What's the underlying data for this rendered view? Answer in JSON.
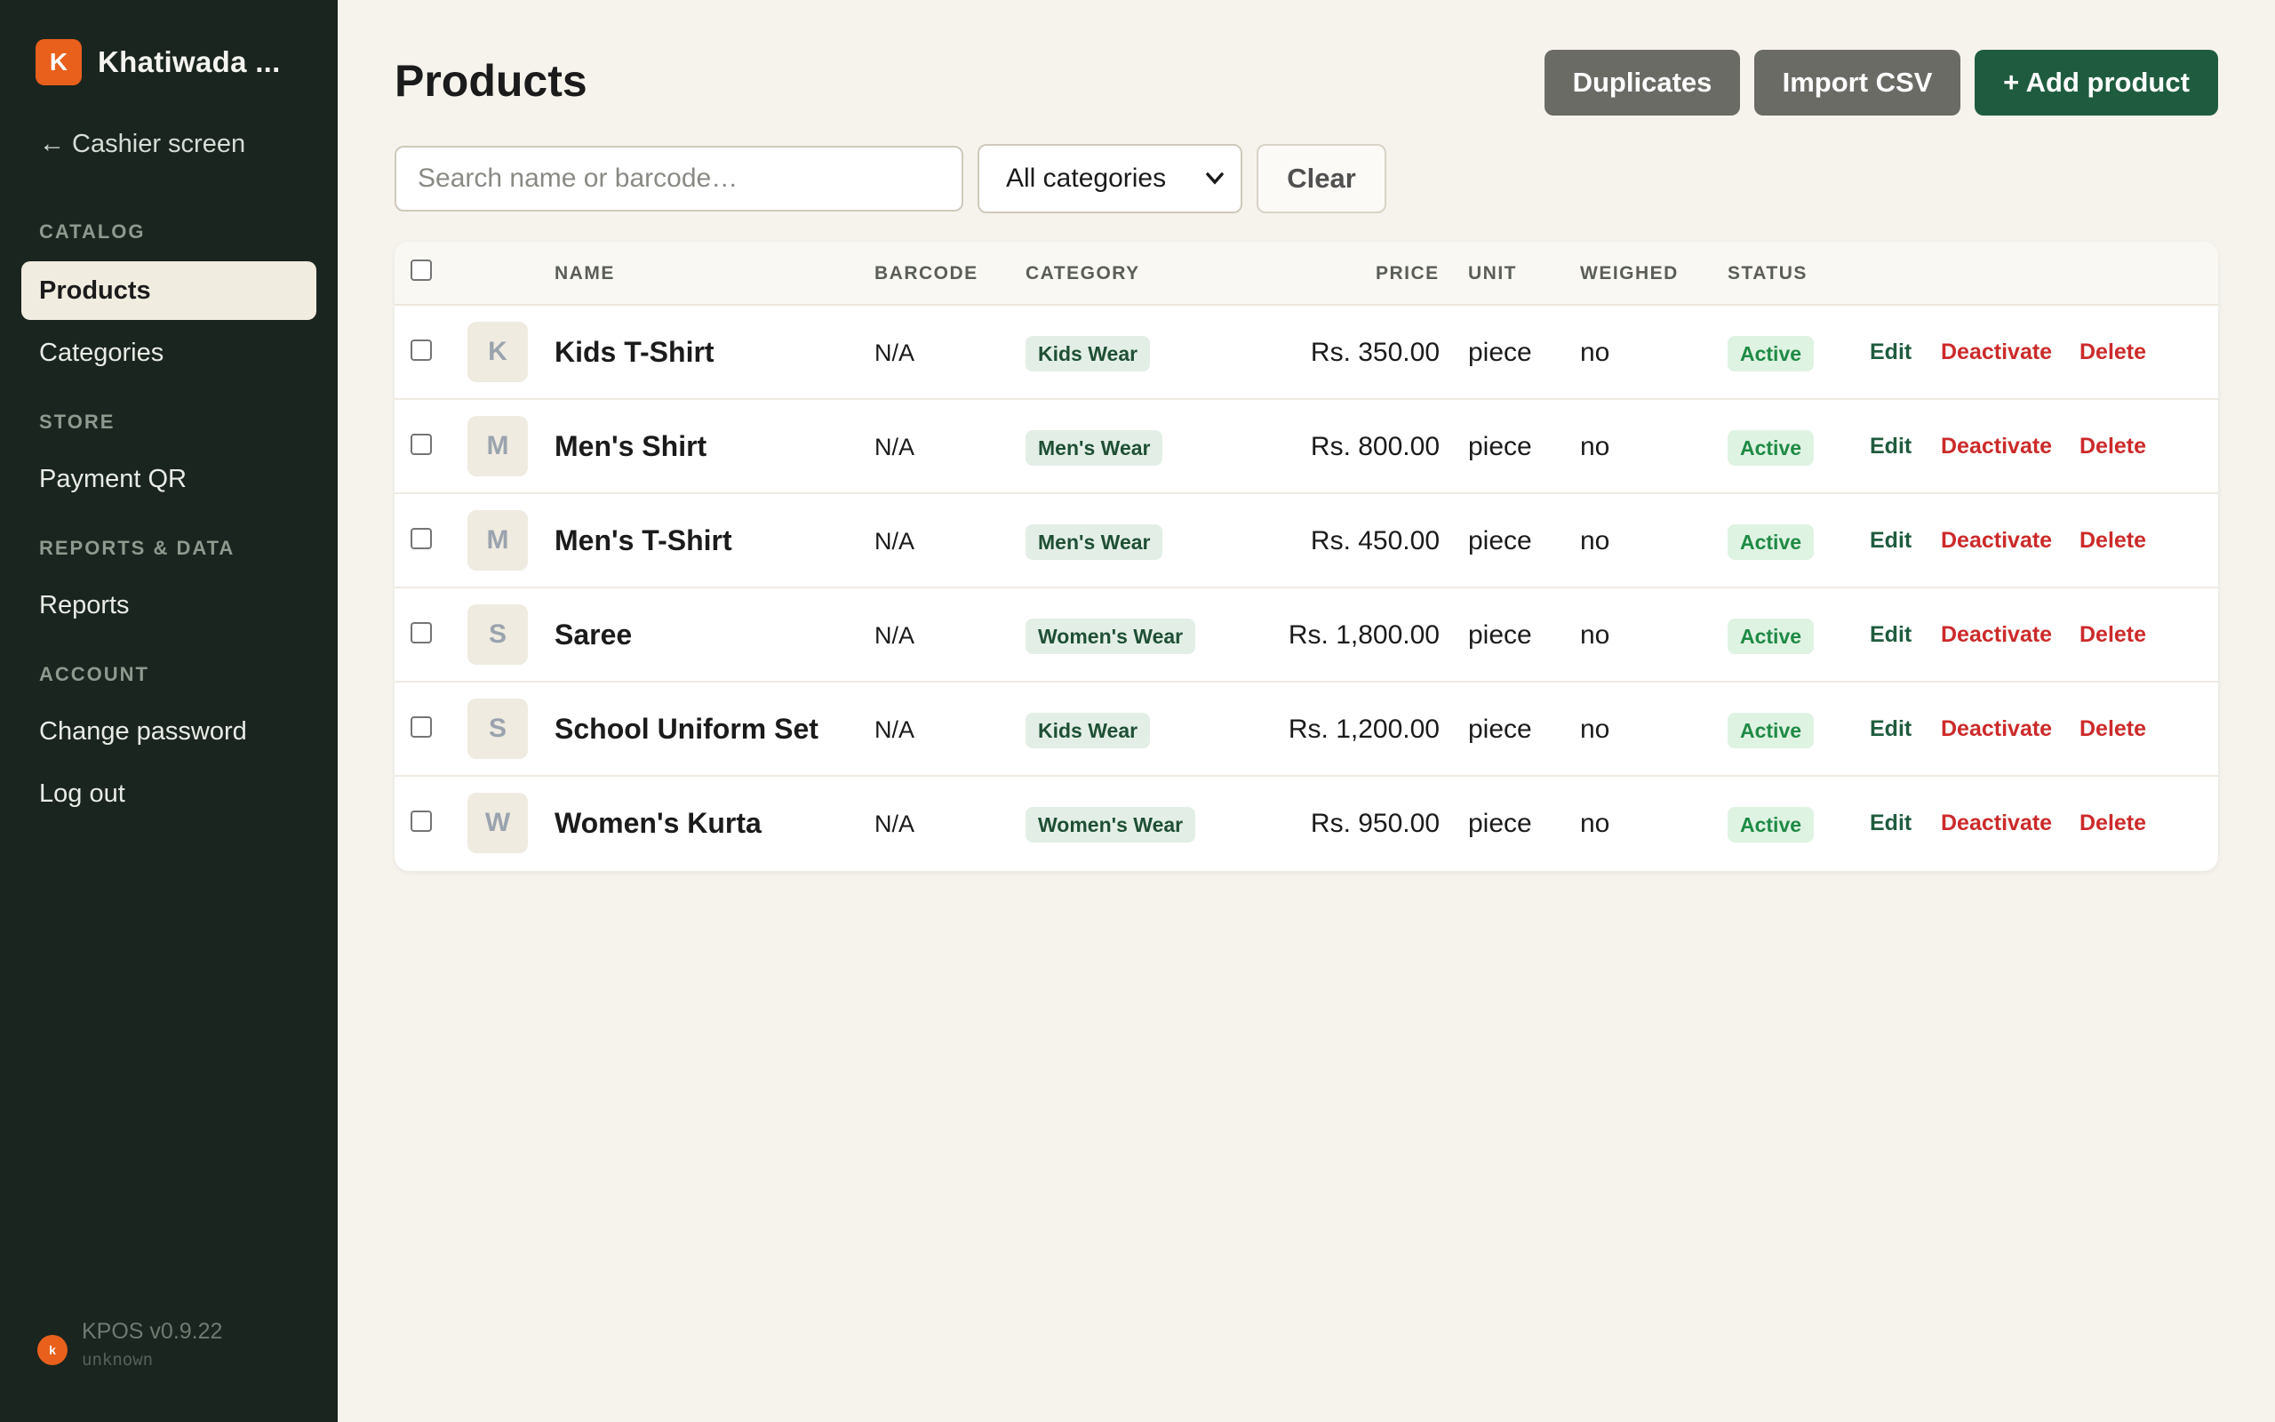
{
  "app": {
    "brand_initial": "K",
    "brand_name": "Khatiwada ..."
  },
  "sidebar": {
    "back_label": "← Cashier screen",
    "sections": [
      {
        "title": "CATALOG",
        "items": [
          {
            "label": "Products",
            "active": true
          },
          {
            "label": "Categories"
          }
        ]
      },
      {
        "title": "STORE",
        "items": [
          {
            "label": "Payment QR"
          }
        ]
      },
      {
        "title": "REPORTS & DATA",
        "items": [
          {
            "label": "Reports"
          }
        ]
      },
      {
        "title": "ACCOUNT",
        "items": [
          {
            "label": "Change password"
          },
          {
            "label": "Log out"
          }
        ]
      }
    ],
    "footer": {
      "logo_initial": "k",
      "version": "KPOS v0.9.22",
      "sub": "unknown"
    }
  },
  "header": {
    "title": "Products",
    "duplicates_label": "Duplicates",
    "import_label": "Import CSV",
    "add_label": "+ Add product"
  },
  "filters": {
    "search_placeholder": "Search name or barcode…",
    "search_value": "",
    "category_selected": "All categories",
    "clear_label": "Clear"
  },
  "table": {
    "columns": {
      "name": "NAME",
      "barcode": "BARCODE",
      "category": "CATEGORY",
      "price": "PRICE",
      "unit": "UNIT",
      "weighed": "WEIGHED",
      "status": "STATUS"
    },
    "actions": {
      "edit": "Edit",
      "deactivate": "Deactivate",
      "delete": "Delete"
    },
    "rows": [
      {
        "initial": "K",
        "name": "Kids T-Shirt",
        "barcode": "N/A",
        "category": "Kids Wear",
        "price": "Rs. 350.00",
        "unit": "piece",
        "weighed": "no",
        "status": "Active"
      },
      {
        "initial": "M",
        "name": "Men's Shirt",
        "barcode": "N/A",
        "category": "Men's Wear",
        "price": "Rs. 800.00",
        "unit": "piece",
        "weighed": "no",
        "status": "Active"
      },
      {
        "initial": "M",
        "name": "Men's T-Shirt",
        "barcode": "N/A",
        "category": "Men's Wear",
        "price": "Rs. 450.00",
        "unit": "piece",
        "weighed": "no",
        "status": "Active"
      },
      {
        "initial": "S",
        "name": "Saree",
        "barcode": "N/A",
        "category": "Women's Wear",
        "price": "Rs. 1,800.00",
        "unit": "piece",
        "weighed": "no",
        "status": "Active"
      },
      {
        "initial": "S",
        "name": "School Uniform Set",
        "barcode": "N/A",
        "category": "Kids Wear",
        "price": "Rs. 1,200.00",
        "unit": "piece",
        "weighed": "no",
        "status": "Active"
      },
      {
        "initial": "W",
        "name": "Women's Kurta",
        "barcode": "N/A",
        "category": "Women's Wear",
        "price": "Rs. 950.00",
        "unit": "piece",
        "weighed": "no",
        "status": "Active"
      }
    ]
  },
  "colors": {
    "sidebar_bg": "#1b251f",
    "brand_accent": "#e8601c",
    "primary_green": "#1f5c3f",
    "danger_red": "#cc2a2a",
    "page_bg": "#f5f3ec"
  }
}
